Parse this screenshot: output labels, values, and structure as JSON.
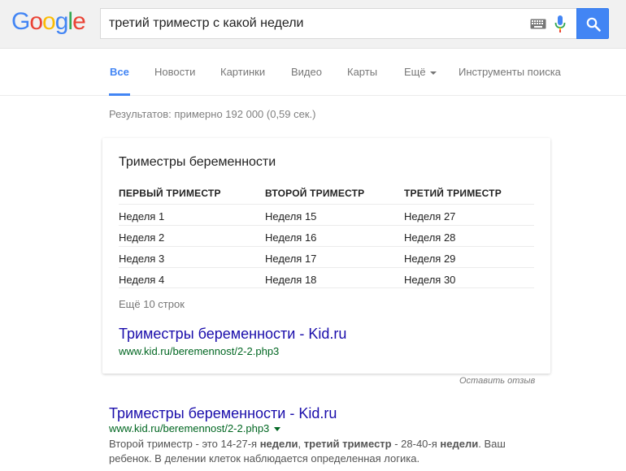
{
  "logo": {
    "text": "Google",
    "letters": [
      {
        "ch": "G",
        "color": "#4285f4"
      },
      {
        "ch": "o",
        "color": "#ea4335"
      },
      {
        "ch": "o",
        "color": "#fbbc05"
      },
      {
        "ch": "g",
        "color": "#4285f4"
      },
      {
        "ch": "l",
        "color": "#34a853"
      },
      {
        "ch": "e",
        "color": "#ea4335"
      }
    ]
  },
  "search": {
    "query": "третий триместр с какой недели",
    "keyboard_icon": "keyboard-icon",
    "mic_icon": "mic-icon",
    "button_icon": "search-icon"
  },
  "tabs": [
    {
      "label": "Все",
      "active": true
    },
    {
      "label": "Новости"
    },
    {
      "label": "Картинки"
    },
    {
      "label": "Видео"
    },
    {
      "label": "Карты"
    },
    {
      "label": "Ещё"
    },
    {
      "label": "Инструменты поиска"
    }
  ],
  "results_stats": "Результатов: примерно 192 000 (0,59 сек.)",
  "featured": {
    "title": "Триместры беременности",
    "columns": [
      "ПЕРВЫЙ ТРИМЕСТР",
      "ВТОРОЙ ТРИМЕСТР",
      "ТРЕТИЙ ТРИМЕСТР"
    ],
    "rows": [
      [
        "Неделя 1",
        "Неделя 15",
        "Неделя 27"
      ],
      [
        "Неделя 2",
        "Неделя 16",
        "Неделя 28"
      ],
      [
        "Неделя 3",
        "Неделя 17",
        "Неделя 29"
      ],
      [
        "Неделя 4",
        "Неделя 18",
        "Неделя 30"
      ]
    ],
    "more_rows": "Ещё 10 строк",
    "link_title": "Триместры беременности - Kid.ru",
    "link_url": "www.kid.ru/beremennost/2-2.php3"
  },
  "feedback": "Оставить отзыв",
  "result": {
    "title": "Триместры беременности - Kid.ru",
    "url": "www.kid.ru/beremennost/2-2.php3",
    "snippet_parts": [
      {
        "t": "Второй триместр - это 14-27-я ",
        "b": false
      },
      {
        "t": "недели",
        "b": true
      },
      {
        "t": ", ",
        "b": false
      },
      {
        "t": "третий триместр",
        "b": true
      },
      {
        "t": " - 28-40-я ",
        "b": false
      },
      {
        "t": "недели",
        "b": true
      },
      {
        "t": ". Ваш ребенок. В делении клеток наблюдается определенная логика.",
        "b": false
      }
    ]
  },
  "colors": {
    "accent": "#4285f4",
    "link": "#1a0dab",
    "url": "#006621"
  }
}
